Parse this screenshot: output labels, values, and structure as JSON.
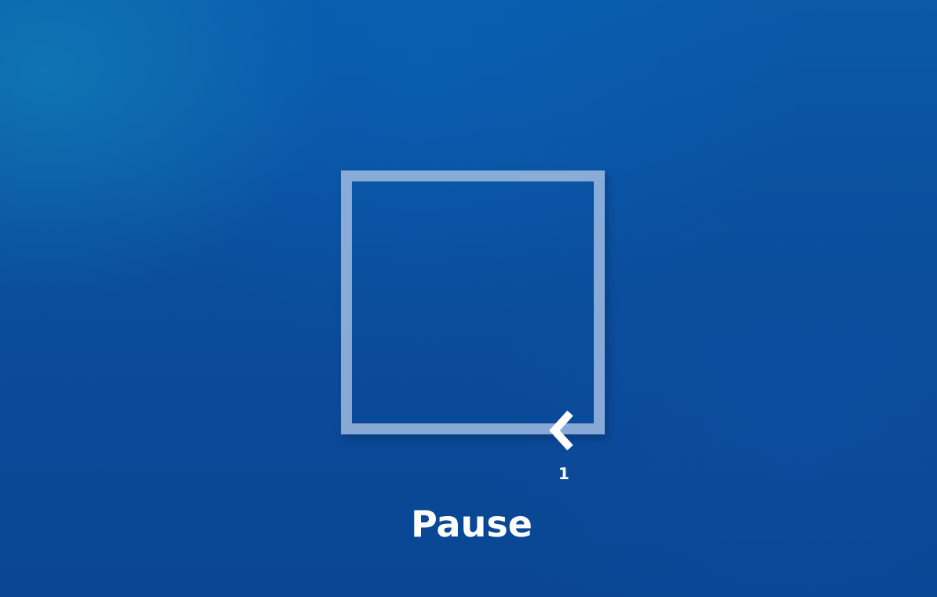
{
  "breathing_exercise": {
    "counter": "1",
    "phase_label": "Pause",
    "progress_marker_icon": "chevron-left-icon"
  },
  "colors": {
    "background": "#0b4d9c",
    "outline": "#acc4e6",
    "text": "#ffffff",
    "marker": "#ffffff"
  }
}
